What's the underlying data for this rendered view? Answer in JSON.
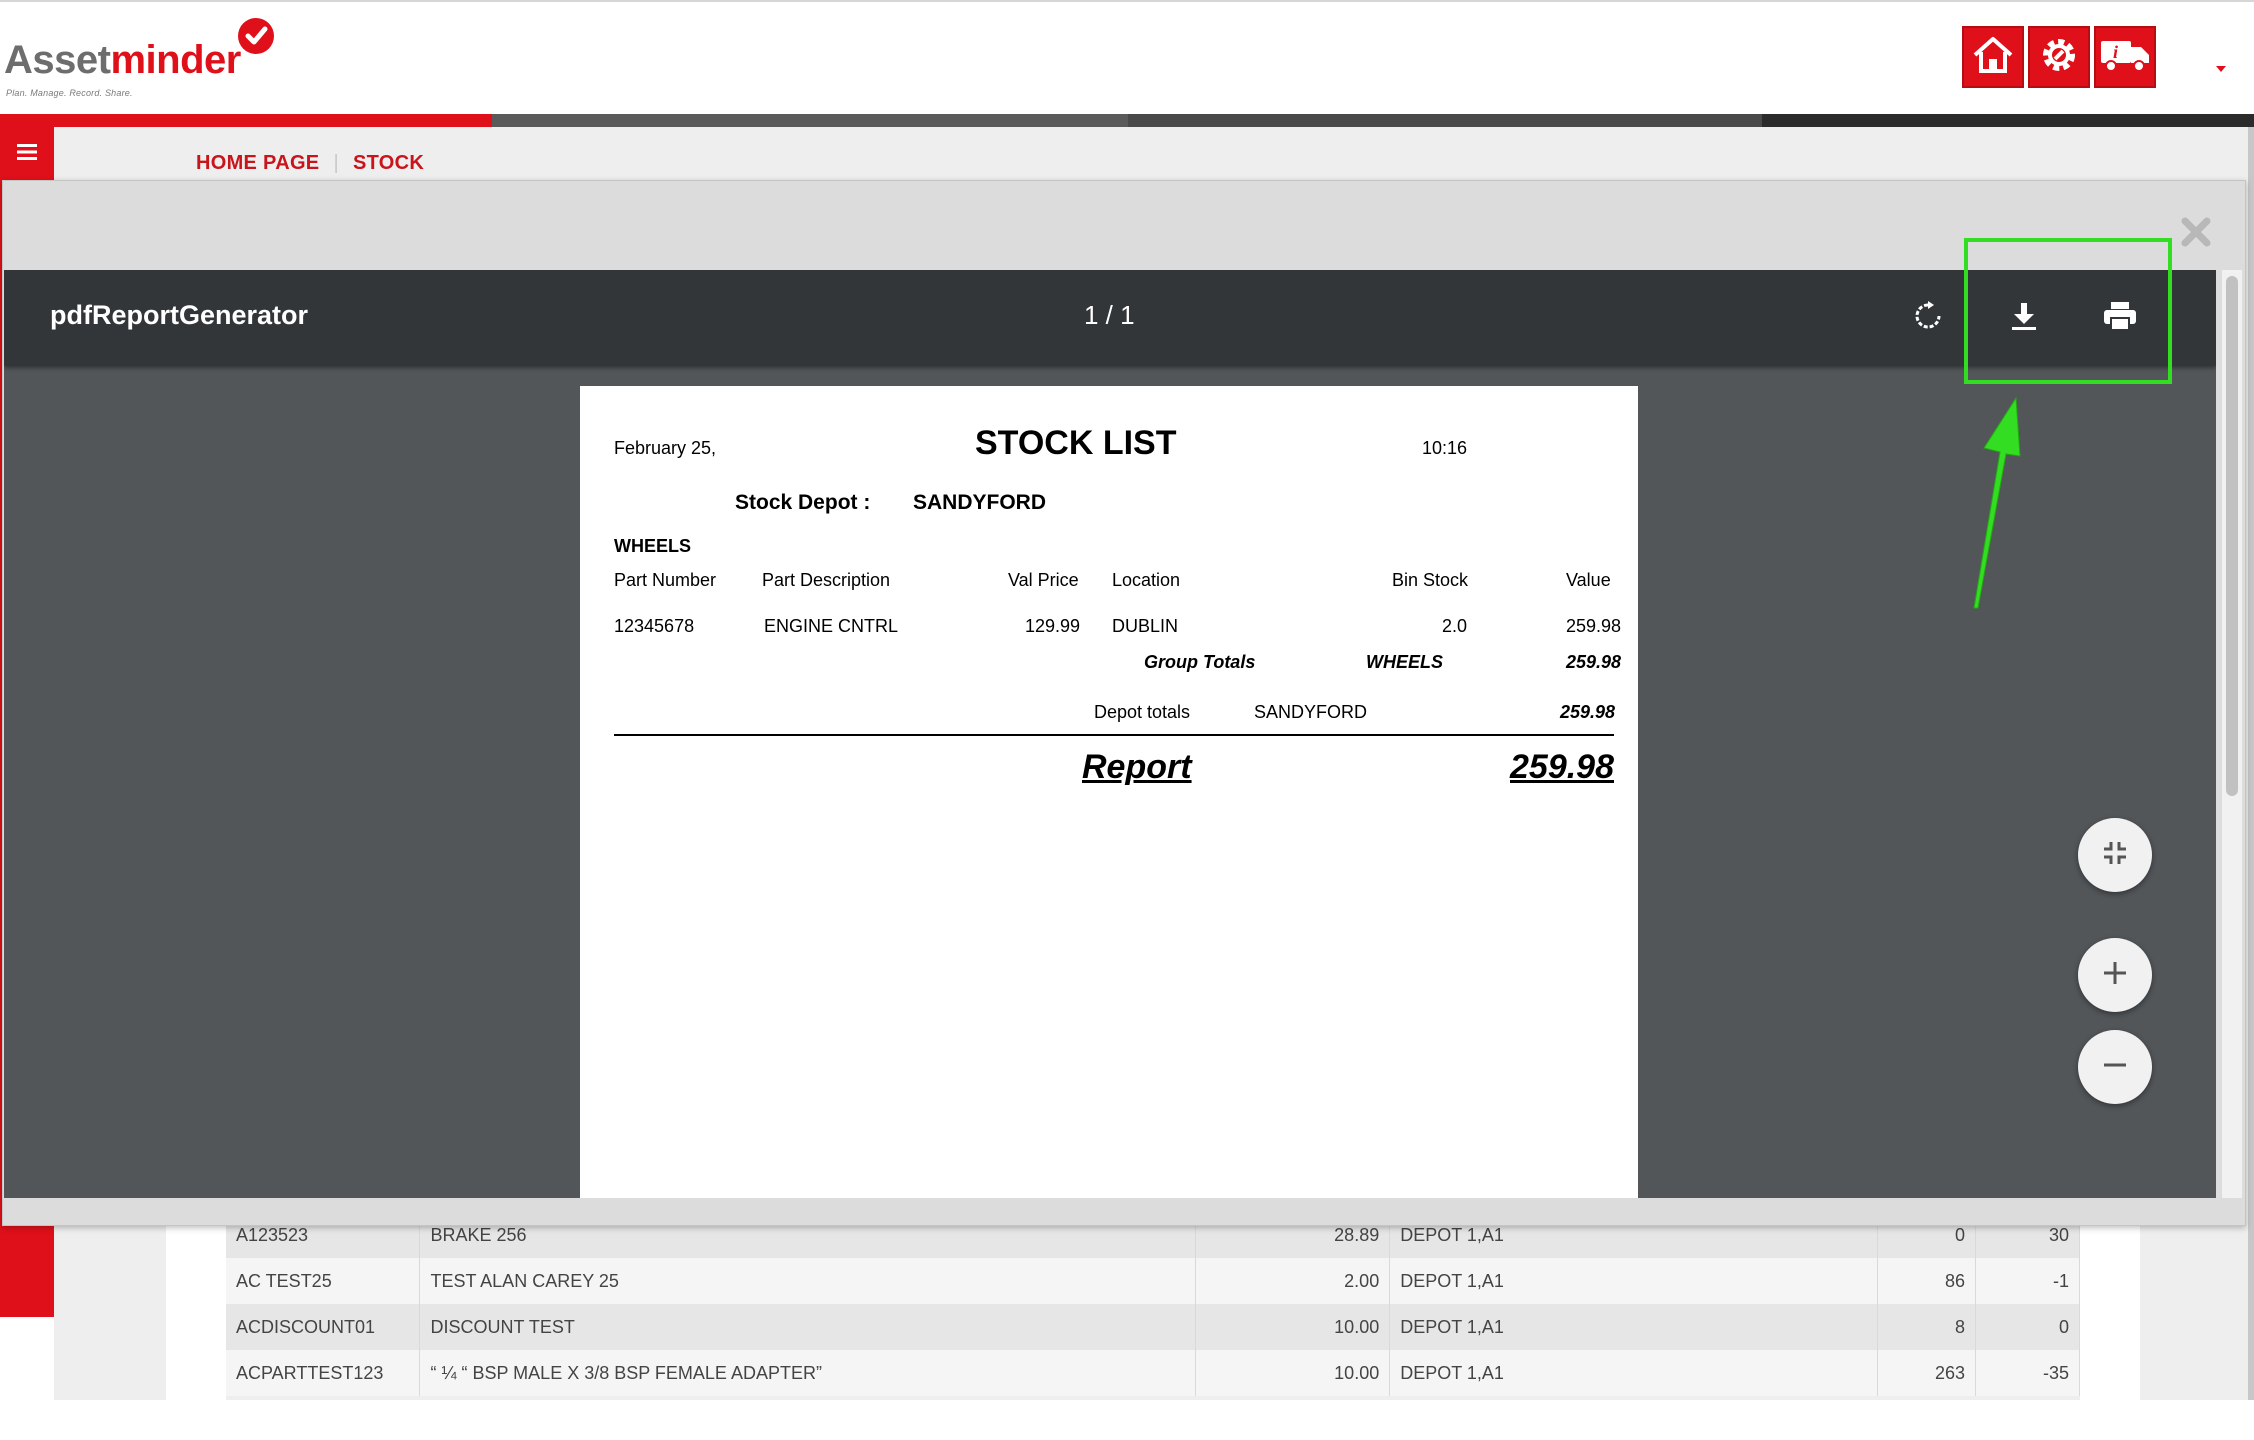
{
  "header": {
    "logo_word_a": "Asset",
    "logo_word_b": "minder",
    "logo_tagline": "Plan. Manage. Record. Share.",
    "buttons": [
      {
        "name": "home-button",
        "icon": "home-icon"
      },
      {
        "name": "settings-button",
        "icon": "gear-icon"
      },
      {
        "name": "vehicle-info-button",
        "icon": "truck-info-icon"
      }
    ]
  },
  "breadcrumb": {
    "home": "HOME PAGE",
    "current": "STOCK"
  },
  "background_table": {
    "rows": [
      {
        "part": "A123523",
        "desc": "BRAKE 256",
        "price": "28.89",
        "loc": "DEPOT 1,A1",
        "qty": "0",
        "diff": "30"
      },
      {
        "part": "AC TEST25",
        "desc": "TEST ALAN CAREY 25",
        "price": "2.00",
        "loc": "DEPOT 1,A1",
        "qty": "86",
        "diff": "-1"
      },
      {
        "part": "ACDISCOUNT01",
        "desc": "DISCOUNT TEST",
        "price": "10.00",
        "loc": "DEPOT 1,A1",
        "qty": "8",
        "diff": "0"
      },
      {
        "part": "ACPARTTEST123",
        "desc": "“ ¼ “ BSP MALE X 3/8 BSP FEMALE ADAPTER”",
        "price": "10.00",
        "loc": "DEPOT 1,A1",
        "qty": "263",
        "diff": "-35"
      }
    ]
  },
  "viewer": {
    "title": "pdfReportGenerator",
    "page_indicator": "1 / 1",
    "icons": {
      "rotate": "rotate-icon",
      "download": "download-icon",
      "print": "print-icon",
      "fit": "compress-icon",
      "zoom_in": "plus-icon",
      "zoom_out": "minus-icon",
      "close": "close-icon"
    }
  },
  "report": {
    "date": "February 25,",
    "title": "STOCK LIST",
    "time": "10:16",
    "depot_label": "Stock Depot :",
    "depot_value": "SANDYFORD",
    "group": "WHEELS",
    "columns": {
      "part_number": "Part Number",
      "part_description": "Part Description",
      "val_price": "Val Price",
      "location": "Location",
      "bin_stock": "Bin Stock",
      "value": "Value"
    },
    "row": {
      "part_number": "12345678",
      "part_description": "ENGINE CNTRL",
      "val_price": "129.99",
      "location": "DUBLIN",
      "bin_stock": "2.0",
      "value": "259.98"
    },
    "group_totals_label": "Group Totals",
    "group_totals_name": "WHEELS",
    "group_totals_value": "259.98",
    "depot_totals_label": "Depot totals",
    "depot_totals_name": "SANDYFORD",
    "depot_totals_value": "259.98",
    "report_label": "Report",
    "report_value": "259.98"
  },
  "annotation": {
    "color": "#33dd22"
  },
  "colors": {
    "brand_red": "#e0101a",
    "toolbar_dark": "#323639",
    "viewer_bg": "#525659"
  }
}
